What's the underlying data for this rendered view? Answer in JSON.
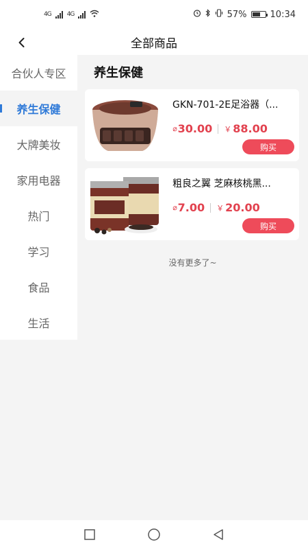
{
  "status_bar": {
    "signal1": "4G",
    "signal2": "4G",
    "battery": "57%",
    "time": "10:34"
  },
  "header": {
    "title": "全部商品"
  },
  "sidebar": {
    "items": [
      {
        "label": "合伙人专区"
      },
      {
        "label": "养生保健"
      },
      {
        "label": "大牌美妆"
      },
      {
        "label": "家用电器"
      },
      {
        "label": "热门"
      },
      {
        "label": "学习"
      },
      {
        "label": "食品"
      },
      {
        "label": "生活"
      }
    ],
    "active_index": 1
  },
  "section": {
    "title": "养生保健"
  },
  "products": [
    {
      "name": "GKN-701-2E足浴器（...",
      "price_coin": "30.00",
      "price_yen": "88.00",
      "buy_label": "购买",
      "image": "foot-bath-icon"
    },
    {
      "name": "粗良之翼 芝麻核桃黑...",
      "price_coin": "7.00",
      "price_yen": "20.00",
      "buy_label": "购买",
      "image": "powder-can-icon"
    }
  ],
  "symbols": {
    "yen": "￥"
  },
  "footer_note": "没有更多了~",
  "colors": {
    "accent": "#2f7ad8",
    "price": "#e2424f",
    "buy_button": "#ee4b5a"
  }
}
